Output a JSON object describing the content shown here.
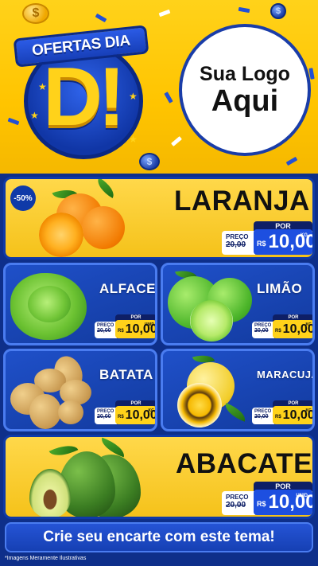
{
  "header": {
    "badge_line1": "OFERTAS DIA",
    "badge_letter": "D!",
    "logo_line1": "Sua Logo",
    "logo_line2": "Aqui",
    "coin_symbol": "$"
  },
  "price_labels": {
    "por": "POR",
    "preco": "PREÇO",
    "currency": "R$"
  },
  "products": {
    "laranja": {
      "name": "LARANJA",
      "discount": "-50%",
      "old": "20,00",
      "value": "10,00",
      "unit": "KG"
    },
    "alface": {
      "name": "ALFACE",
      "old": "20,00",
      "value": "10,00",
      "unit": "UNID"
    },
    "limao": {
      "name": "LIMÃO",
      "old": "20,00",
      "value": "10,00",
      "unit": "KG"
    },
    "batata": {
      "name": "BATATA",
      "old": "20,00",
      "value": "10,00",
      "unit": "KG"
    },
    "maracuja": {
      "name": "MARACUJÁ",
      "old": "20,00",
      "value": "10,00",
      "unit": "KG"
    },
    "abacate": {
      "name": "ABACATE",
      "old": "20,00",
      "value": "10,00",
      "unit": "UNID"
    }
  },
  "footer": {
    "cta": "Crie seu encarte com este tema!",
    "disclaimer": "*Imagens Meramente Ilustrativas"
  },
  "colors": {
    "yellow": "#ffd21a",
    "blue": "#1d4fe0",
    "navy": "#0e1f66"
  }
}
